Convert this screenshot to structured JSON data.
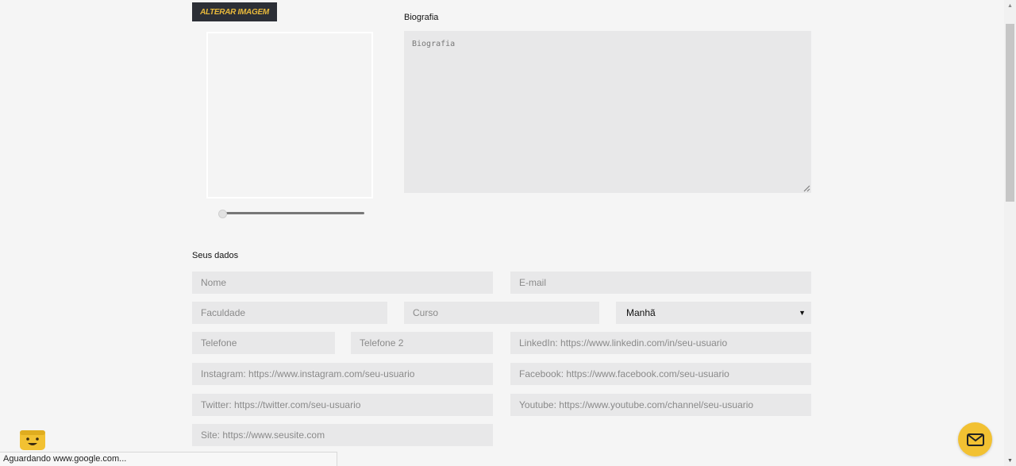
{
  "profile": {
    "change_image_label": "ALTERAR IMAGEM",
    "zoom_level": 0.02
  },
  "bio": {
    "label": "Biografia",
    "placeholder": "Biografia"
  },
  "data_section": {
    "label": "Seus dados",
    "fields": {
      "name": "Nome",
      "email": "E-mail",
      "college": "Faculdade",
      "course": "Curso",
      "phone": "Telefone",
      "phone2": "Telefone 2",
      "linkedin": "LinkedIn: https://www.linkedin.com/in/seu-usuario",
      "instagram": "Instagram: https://www.instagram.com/seu-usuario",
      "facebook": "Facebook: https://www.facebook.com/seu-usuario",
      "twitter": "Twitter: https://twitter.com/seu-usuario",
      "youtube": "Youtube: https://www.youtube.com/channel/seu-usuario",
      "site": "Site: https://www.seusite.com"
    },
    "shift_selected": "Manhã"
  },
  "status_bar": {
    "text": "Aguardando www.google.com..."
  },
  "colors": {
    "accent": "#f2c132",
    "button_bg": "#2c2f36",
    "button_text": "#e8b93b",
    "field_bg": "#e8e8e9"
  }
}
